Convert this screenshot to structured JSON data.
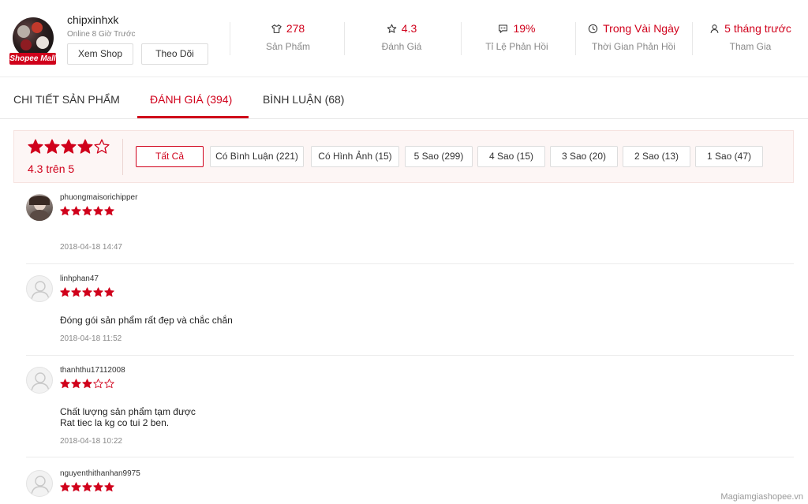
{
  "shop": {
    "name": "chipxinhxk",
    "online_status": "Online 8 Giờ Trước",
    "mall_badge": "Shopee Mall",
    "view_button": "Xem Shop",
    "follow_button": "Theo Dõi",
    "stats": [
      {
        "icon": "shirt-icon",
        "value": "278",
        "label": "Sản Phẩm"
      },
      {
        "icon": "star-icon",
        "value": "4.3",
        "label": "Đánh Giá"
      },
      {
        "icon": "chat-icon",
        "value": "19%",
        "label": "Tỉ Lệ Phản Hồi"
      },
      {
        "icon": "clock-icon",
        "value": "Trong Vài Ngày",
        "label": "Thời Gian Phản Hồi"
      },
      {
        "icon": "user-icon",
        "value": "5 tháng trước",
        "label": "Tham Gia"
      }
    ]
  },
  "tabs": [
    {
      "label": "CHI TIẾT SẢN PHẨM",
      "active": false
    },
    {
      "label": "ĐÁNH GIÁ (394)",
      "active": true
    },
    {
      "label": "BÌNH LUẬN (68)",
      "active": false
    }
  ],
  "rating_summary": {
    "stars_filled": 4,
    "stars_total": 5,
    "text": "4.3 trên 5"
  },
  "filters": [
    {
      "label": "Tất Cả",
      "active": true
    },
    {
      "label": "Có Bình Luận (221)",
      "active": false
    },
    {
      "label": "Có Hình Ảnh (15)",
      "active": false
    },
    {
      "label": "5 Sao (299)",
      "active": false
    },
    {
      "label": "4 Sao (15)",
      "active": false
    },
    {
      "label": "3 Sao (20)",
      "active": false
    },
    {
      "label": "2 Sao (13)",
      "active": false
    },
    {
      "label": "1 Sao (47)",
      "active": false
    }
  ],
  "reviews": [
    {
      "username": "phuongmaisorichipper",
      "stars": 5,
      "comment_lines": [],
      "date": "2018-04-18 14:47",
      "has_photo_avatar": true
    },
    {
      "username": "linhphan47",
      "stars": 5,
      "comment_lines": [
        " Đóng gói sản phẩm rất đẹp và chắc chắn"
      ],
      "date": "2018-04-18 11:52",
      "has_photo_avatar": false
    },
    {
      "username": "thanhthu17112008",
      "stars": 3,
      "comment_lines": [
        " Chất lượng sản phẩm tạm được",
        "Rat tiec la kg co tui 2 ben."
      ],
      "date": "2018-04-18 10:22",
      "has_photo_avatar": false
    },
    {
      "username": "nguyenthithanhan9975",
      "stars": 5,
      "comment_lines": [],
      "date": "",
      "has_photo_avatar": false
    }
  ],
  "watermark": "Magiamgiashopee.vn",
  "colors": {
    "accent": "#d0011b",
    "muted": "#888888",
    "border": "#dddddd"
  }
}
